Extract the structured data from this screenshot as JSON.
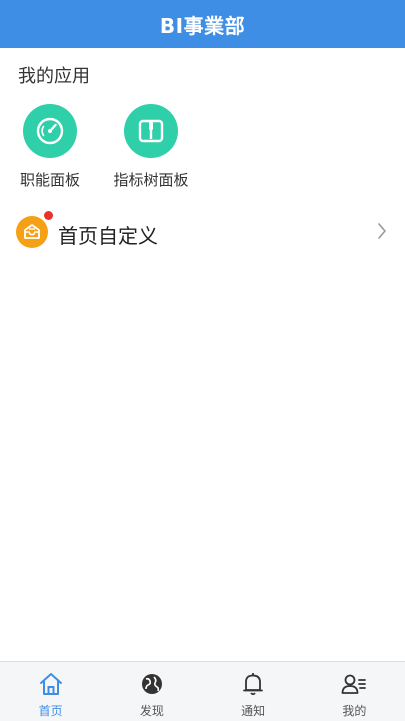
{
  "header": {
    "title": "BI事業部"
  },
  "apps": {
    "section_title": "我的应用",
    "items": [
      {
        "label": "职能面板",
        "icon": "gauge-icon"
      },
      {
        "label": "指标树面板",
        "icon": "book-icon"
      }
    ]
  },
  "custom": {
    "label": "首页自定义",
    "icon": "inbox-icon",
    "badge": "notification-dot"
  },
  "tabbar": {
    "items": [
      {
        "label": "首页",
        "icon": "home-icon",
        "active": true
      },
      {
        "label": "发现",
        "icon": "globe-icon"
      },
      {
        "label": "通知",
        "icon": "bell-icon"
      },
      {
        "label": "我的",
        "icon": "user-list-icon"
      }
    ]
  },
  "colors": {
    "primary": "#3e8ee6",
    "app_tile": "#2fcfa9",
    "custom_icon": "#f5a016",
    "badge": "#e8332a"
  }
}
